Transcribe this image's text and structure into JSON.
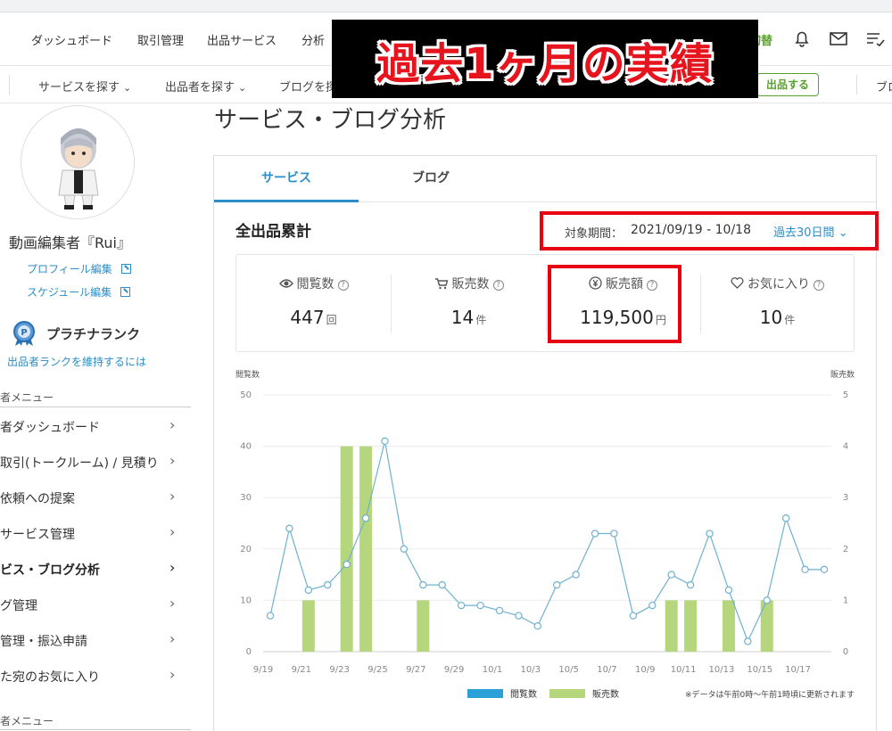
{
  "topnav": {
    "items": [
      "ダッシュボード",
      "取引管理",
      "出品サービス",
      "分析"
    ],
    "switch_label": "切替"
  },
  "subnav": {
    "items": [
      "サービスを探す",
      "出品者を探す",
      "ブログを探"
    ],
    "listing_button": "出品する",
    "right_cut": "ブロ"
  },
  "banner": {
    "text": "過去1ヶ月の実績"
  },
  "sidebar": {
    "profile_name": "動画編集者『Rui』",
    "profile_edit": "プロフィール編集",
    "schedule_edit": "スケジュール編集",
    "rank_label": "プラチナランク",
    "rank_link": "出品者ランクを維持するには",
    "menu_head_1": "者メニュー",
    "menu_head_2": "者メニュー",
    "menu": [
      {
        "label": "者ダッシュボード",
        "active": false
      },
      {
        "label": "取引(トークルーム) / 見積り",
        "active": false
      },
      {
        "label": "依頼への提案",
        "active": false
      },
      {
        "label": "サービス管理",
        "active": false
      },
      {
        "label": "ビス・ブログ分析",
        "active": true
      },
      {
        "label": "グ管理",
        "active": false
      },
      {
        "label": "管理・振込申請",
        "active": false
      },
      {
        "label": "た宛のお気に入り",
        "active": false
      }
    ]
  },
  "main": {
    "page_title": "サービス・ブログ分析",
    "tabs": [
      "サービス",
      "ブログ"
    ],
    "section_title": "全出品累計",
    "period_label": "対象期間：",
    "period_value": "2021/09/19 - 10/18",
    "period_range": "過去30日間",
    "stats": [
      {
        "label": "閲覧数",
        "value": "447",
        "unit": "回",
        "icon": "eye-icon"
      },
      {
        "label": "販売数",
        "value": "14",
        "unit": "件",
        "icon": "cart-icon"
      },
      {
        "label": "販売額",
        "value": "119,500",
        "unit": "円",
        "icon": "yen-icon"
      },
      {
        "label": "お気に入り",
        "value": "10",
        "unit": "件",
        "icon": "heart-icon"
      }
    ]
  },
  "colors": {
    "accent_blue": "#2a8ec8",
    "green": "#5aa02c",
    "bar_green": "#b5d67c",
    "line_blue": "#6fb1d0",
    "legend_blue": "#2a9fd8",
    "highlight_red": "#e60012"
  },
  "chart_data": {
    "type": "bar+line",
    "left_axis_label": "閲覧数",
    "right_axis_label": "販売数",
    "left_ylim": [
      0,
      50
    ],
    "right_ylim": [
      0,
      5
    ],
    "left_ticks": [
      "0",
      "10",
      "20",
      "30",
      "40",
      "50"
    ],
    "right_ticks": [
      "0",
      "1",
      "2",
      "3",
      "4",
      "5"
    ],
    "x": [
      "9/19",
      "9/20",
      "9/21",
      "9/22",
      "9/23",
      "9/24",
      "9/25",
      "9/26",
      "9/27",
      "9/28",
      "9/29",
      "9/30",
      "10/1",
      "10/2",
      "10/3",
      "10/4",
      "10/5",
      "10/6",
      "10/7",
      "10/8",
      "10/9",
      "10/10",
      "10/11",
      "10/12",
      "10/13",
      "10/14",
      "10/15",
      "10/16",
      "10/17",
      "10/18"
    ],
    "x_tick_labels": [
      "9/19",
      "9/21",
      "9/23",
      "9/25",
      "9/27",
      "9/29",
      "10/1",
      "10/3",
      "10/5",
      "10/7",
      "10/9",
      "10/11",
      "10/13",
      "10/15",
      "10/17"
    ],
    "series": [
      {
        "name": "閲覧数",
        "type": "line",
        "axis": "left",
        "values": [
          7,
          24,
          12,
          13,
          17,
          26,
          41,
          20,
          13,
          13,
          9,
          9,
          8,
          7,
          5,
          13,
          15,
          23,
          23,
          7,
          9,
          15,
          13,
          23,
          12,
          2,
          10,
          26,
          16,
          16
        ]
      },
      {
        "name": "販売数",
        "type": "bar",
        "axis": "right",
        "values": [
          0,
          0,
          1,
          0,
          4,
          4,
          0,
          0,
          1,
          0,
          0,
          0,
          0,
          0,
          0,
          0,
          0,
          0,
          0,
          0,
          0,
          1,
          1,
          0,
          1,
          0,
          1,
          0,
          0,
          0
        ]
      }
    ],
    "legend": [
      "閲覧数",
      "販売数"
    ],
    "legend_position": "bottom",
    "footnote": "※データは午前0時〜午前1時頃に更新されます",
    "grid": true
  }
}
